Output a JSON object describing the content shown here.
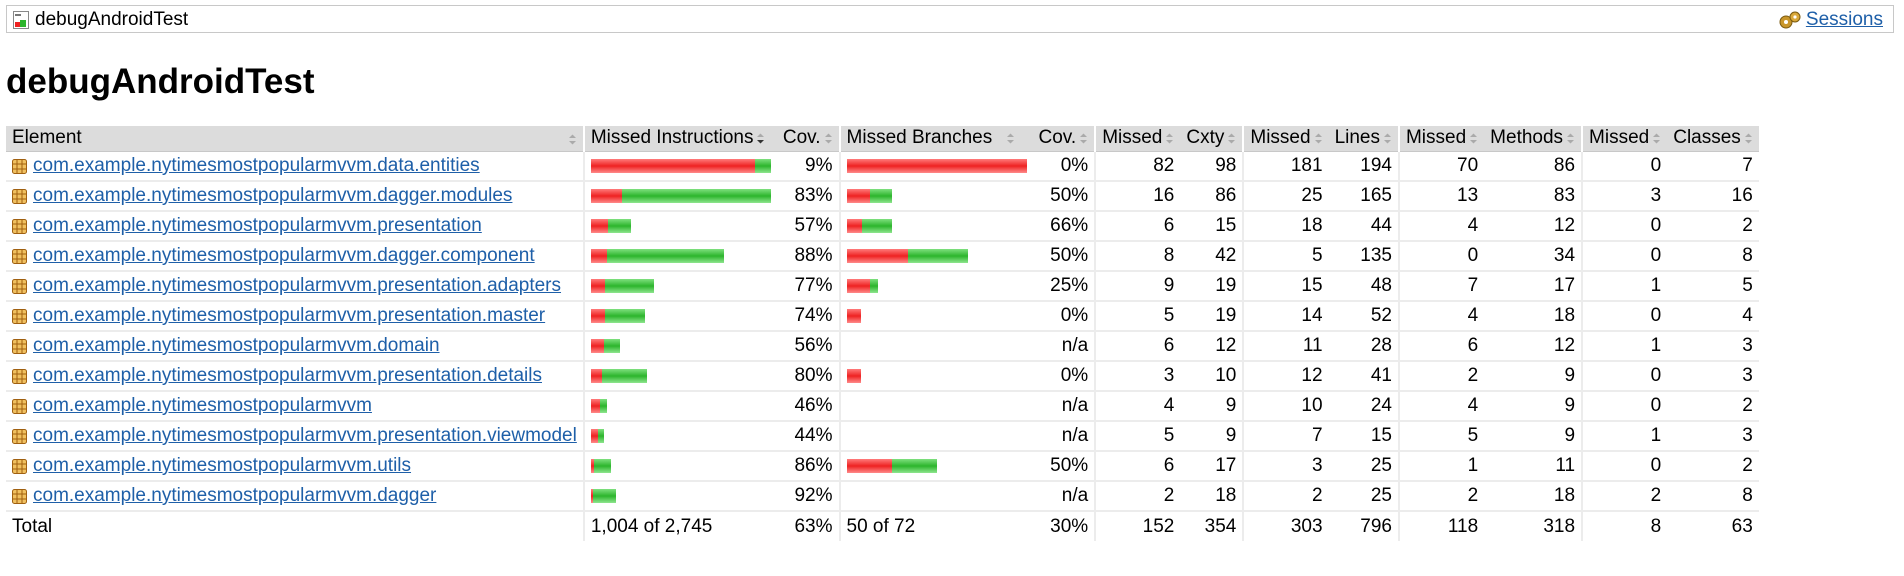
{
  "breadcrumb": {
    "report_name": "debugAndroidTest",
    "sessions_label": "Sessions"
  },
  "page_title": "debugAndroidTest",
  "colors": {
    "missed": "#e22222",
    "covered": "#2cb52c",
    "link": "#1e5fa8",
    "header_bg": "#dcdcdc"
  },
  "headers": {
    "element": "Element",
    "missed_instructions": "Missed Instructions",
    "cov1": "Cov.",
    "missed_branches": "Missed Branches",
    "cov2": "Cov.",
    "missed_cxty": "Missed",
    "cxty": "Cxty",
    "missed_lines": "Missed",
    "lines": "Lines",
    "missed_methods": "Missed",
    "methods": "Methods",
    "missed_classes": "Missed",
    "classes": "Classes"
  },
  "rows": [
    {
      "name": "com.example.nytimesmostpopularmvvm.data.entities",
      "instr_missed_frac": 0.91,
      "instr_scale": 1.0,
      "instr_cov": "9%",
      "br_missed_frac": 1.0,
      "br_scale": 1.0,
      "br_cov": "0%",
      "missed_cxty": "82",
      "cxty": "98",
      "missed_lines": "181",
      "lines": "194",
      "missed_methods": "70",
      "methods": "86",
      "missed_classes": "0",
      "classes": "7"
    },
    {
      "name": "com.example.nytimesmostpopularmvvm.dagger.modules",
      "instr_missed_frac": 0.17,
      "instr_scale": 1.0,
      "instr_cov": "83%",
      "br_missed_frac": 0.5,
      "br_scale": 0.25,
      "br_cov": "50%",
      "missed_cxty": "16",
      "cxty": "86",
      "missed_lines": "25",
      "lines": "165",
      "missed_methods": "13",
      "methods": "83",
      "missed_classes": "3",
      "classes": "16"
    },
    {
      "name": "com.example.nytimesmostpopularmvvm.presentation",
      "instr_missed_frac": 0.43,
      "instr_scale": 0.22,
      "instr_cov": "57%",
      "br_missed_frac": 0.34,
      "br_scale": 0.25,
      "br_cov": "66%",
      "missed_cxty": "6",
      "cxty": "15",
      "missed_lines": "18",
      "lines": "44",
      "missed_methods": "4",
      "methods": "12",
      "missed_classes": "0",
      "classes": "2"
    },
    {
      "name": "com.example.nytimesmostpopularmvvm.dagger.component",
      "instr_missed_frac": 0.12,
      "instr_scale": 0.74,
      "instr_cov": "88%",
      "br_missed_frac": 0.5,
      "br_scale": 0.67,
      "br_cov": "50%",
      "missed_cxty": "8",
      "cxty": "42",
      "missed_lines": "5",
      "lines": "135",
      "missed_methods": "0",
      "methods": "34",
      "missed_classes": "0",
      "classes": "8"
    },
    {
      "name": "com.example.nytimesmostpopularmvvm.presentation.adapters",
      "instr_missed_frac": 0.23,
      "instr_scale": 0.35,
      "instr_cov": "77%",
      "br_missed_frac": 0.75,
      "br_scale": 0.17,
      "br_cov": "25%",
      "missed_cxty": "9",
      "cxty": "19",
      "missed_lines": "15",
      "lines": "48",
      "missed_methods": "7",
      "methods": "17",
      "missed_classes": "1",
      "classes": "5"
    },
    {
      "name": "com.example.nytimesmostpopularmvvm.presentation.master",
      "instr_missed_frac": 0.26,
      "instr_scale": 0.3,
      "instr_cov": "74%",
      "br_missed_frac": 1.0,
      "br_scale": 0.08,
      "br_cov": "0%",
      "missed_cxty": "5",
      "cxty": "19",
      "missed_lines": "14",
      "lines": "52",
      "missed_methods": "4",
      "methods": "18",
      "missed_classes": "0",
      "classes": "4"
    },
    {
      "name": "com.example.nytimesmostpopularmvvm.domain",
      "instr_missed_frac": 0.44,
      "instr_scale": 0.16,
      "instr_cov": "56%",
      "br_missed_frac": 0,
      "br_scale": 0,
      "br_cov": "n/a",
      "missed_cxty": "6",
      "cxty": "12",
      "missed_lines": "11",
      "lines": "28",
      "missed_methods": "6",
      "methods": "12",
      "missed_classes": "1",
      "classes": "3"
    },
    {
      "name": "com.example.nytimesmostpopularmvvm.presentation.details",
      "instr_missed_frac": 0.2,
      "instr_scale": 0.31,
      "instr_cov": "80%",
      "br_missed_frac": 1.0,
      "br_scale": 0.08,
      "br_cov": "0%",
      "missed_cxty": "3",
      "cxty": "10",
      "missed_lines": "12",
      "lines": "41",
      "missed_methods": "2",
      "methods": "9",
      "missed_classes": "0",
      "classes": "3"
    },
    {
      "name": "com.example.nytimesmostpopularmvvm",
      "instr_missed_frac": 0.54,
      "instr_scale": 0.09,
      "instr_cov": "46%",
      "br_missed_frac": 0,
      "br_scale": 0,
      "br_cov": "n/a",
      "missed_cxty": "4",
      "cxty": "9",
      "missed_lines": "10",
      "lines": "24",
      "missed_methods": "4",
      "methods": "9",
      "missed_classes": "0",
      "classes": "2"
    },
    {
      "name": "com.example.nytimesmostpopularmvvm.presentation.viewmodel",
      "instr_missed_frac": 0.56,
      "instr_scale": 0.07,
      "instr_cov": "44%",
      "br_missed_frac": 0,
      "br_scale": 0,
      "br_cov": "n/a",
      "missed_cxty": "5",
      "cxty": "9",
      "missed_lines": "7",
      "lines": "15",
      "missed_methods": "5",
      "methods": "9",
      "missed_classes": "1",
      "classes": "3"
    },
    {
      "name": "com.example.nytimesmostpopularmvvm.utils",
      "instr_missed_frac": 0.14,
      "instr_scale": 0.11,
      "instr_cov": "86%",
      "br_missed_frac": 0.5,
      "br_scale": 0.5,
      "br_cov": "50%",
      "missed_cxty": "6",
      "cxty": "17",
      "missed_lines": "3",
      "lines": "25",
      "missed_methods": "1",
      "methods": "11",
      "missed_classes": "0",
      "classes": "2"
    },
    {
      "name": "com.example.nytimesmostpopularmvvm.dagger",
      "instr_missed_frac": 0.08,
      "instr_scale": 0.14,
      "instr_cov": "92%",
      "br_missed_frac": 0,
      "br_scale": 0,
      "br_cov": "n/a",
      "missed_cxty": "2",
      "cxty": "18",
      "missed_lines": "2",
      "lines": "25",
      "missed_methods": "2",
      "methods": "18",
      "missed_classes": "2",
      "classes": "8"
    }
  ],
  "total": {
    "label": "Total",
    "instr": "1,004 of 2,745",
    "instr_cov": "63%",
    "br": "50 of 72",
    "br_cov": "30%",
    "missed_cxty": "152",
    "cxty": "354",
    "missed_lines": "303",
    "lines": "796",
    "missed_methods": "118",
    "methods": "318",
    "missed_classes": "8",
    "classes": "63"
  }
}
